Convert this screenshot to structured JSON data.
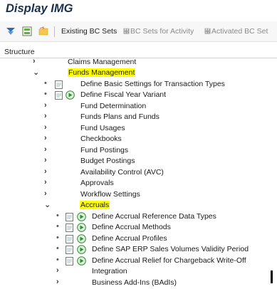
{
  "title": "Display IMG",
  "toolbar": {
    "existing_bc_sets": "Existing BC Sets",
    "bc_sets_for_activity": "BC Sets for Activity",
    "activated_bc_sets": "Activated BC Set"
  },
  "structure": {
    "header": "Structure",
    "claims_management": "Claims Management",
    "funds_management": "Funds Management",
    "basic_settings": "Define Basic Settings for Transaction Types",
    "fiscal_year_variant": "Define Fiscal Year Variant",
    "fund_determination": "Fund Determination",
    "funds_plans": "Funds Plans and Funds",
    "fund_usages": "Fund Usages",
    "checkbooks": "Checkbooks",
    "fund_postings": "Fund Postings",
    "budget_postings": "Budget Postings",
    "availability_control": "Availability Control (AVC)",
    "approvals": "Approvals",
    "workflow_settings": "Workflow Settings",
    "accruals": "Accruals",
    "accrual_reference_data": "Define Accrual Reference Data Types",
    "accrual_methods": "Define Accrual Methods",
    "accrual_profiles": "Define Accrual Profiles",
    "sap_erp_sales_volumes": "Define SAP ERP Sales Volumes Validity Period",
    "accrual_relief": "Define Accrual Relief for Chargeback Write-Off",
    "integration": "Integration",
    "business_addins": "Business Add-Ins (BAdIs)"
  },
  "colors": {
    "highlight": "#ffff00",
    "title": "#1c2f4f",
    "exec_icon": "#2e8b3a"
  }
}
